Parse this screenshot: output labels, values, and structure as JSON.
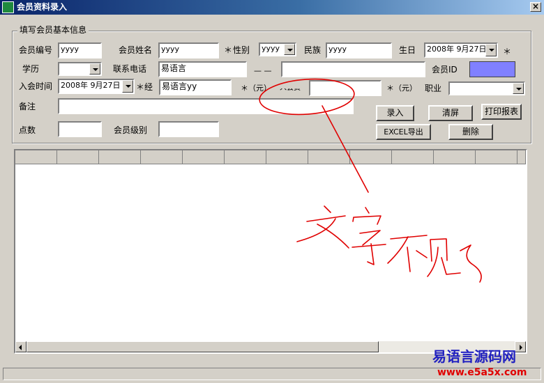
{
  "window": {
    "title": "会员资料录入",
    "close_glyph": "×"
  },
  "group": {
    "title": "填写会员基本信息"
  },
  "labels": {
    "member_no": "会员编号",
    "member_name": "会员姓名",
    "required1": "＊",
    "gender": "性别",
    "ethnicity": "民族",
    "birthday": "生日",
    "required_birthday": "＊",
    "education": "学历",
    "phone": "联系电话",
    "phone_dash": "— —",
    "member_id": "会员ID",
    "join_time": "入会时间",
    "handler": "＊经",
    "yuan1": "＊（元）",
    "hidden_label": "入会费",
    "yuan2": "＊（元）",
    "occupation": "职业",
    "remark": "备注",
    "points": "点数",
    "level": "会员级别"
  },
  "fields": {
    "member_no": "yyyy",
    "member_name": "yyyy",
    "gender": "yyyy",
    "ethnicity": "yyyy",
    "birthday": "2008年 9月27日",
    "education": "",
    "phone": "易语言",
    "phone_ext": "",
    "join_time": "2008年 9月27日",
    "handler": "易语言yy",
    "fee": "",
    "occupation": "",
    "remark": "",
    "points": "",
    "level": ""
  },
  "buttons": {
    "enter": "录入",
    "clear": "清屏",
    "print": "打印报表",
    "excel": "EXCEL导出",
    "delete": "删除"
  },
  "colors": {
    "member_id_box": "#8080ff",
    "annotation": "#e00000"
  },
  "annotation": {
    "text": "文字不见了"
  },
  "watermark": {
    "line1": "易语言源码网",
    "line2": "www.e5a5x.com"
  }
}
